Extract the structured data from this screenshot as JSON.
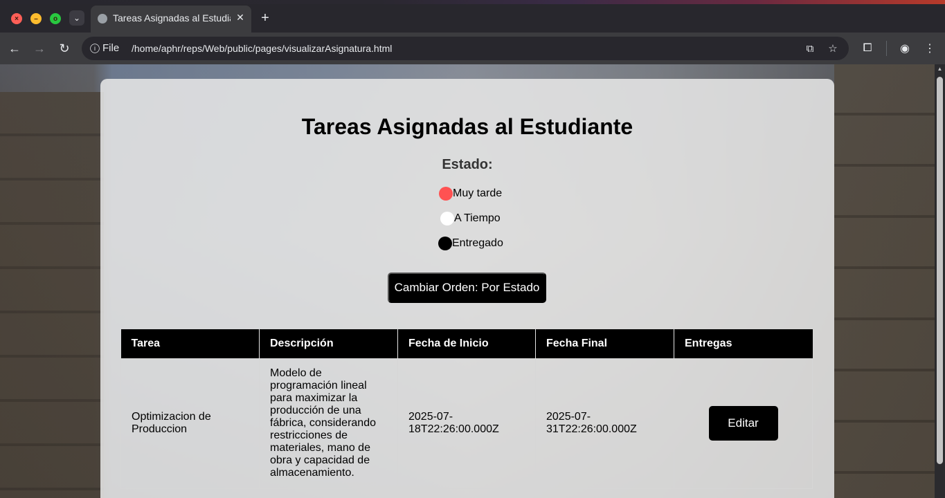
{
  "browser": {
    "tab_title": "Tareas Asignadas al Estudiante",
    "scheme_label": "File",
    "url": "/home/aphr/reps/Web/public/pages/visualizarAsignatura.html",
    "window_buttons": {
      "close": "×",
      "minimize": "–",
      "maximize": "o"
    }
  },
  "page": {
    "title": "Tareas Asignadas al Estudiante",
    "estado_heading": "Estado:",
    "legend": [
      {
        "label": "Muy tarde",
        "color": "#ff5252"
      },
      {
        "label": "A Tiempo",
        "color": "#ffffff"
      },
      {
        "label": "Entregado",
        "color": "#000000"
      }
    ],
    "order_button": "Cambiar Orden: Por Estado"
  },
  "table": {
    "headers": [
      "Tarea",
      "Descripción",
      "Fecha de Inicio",
      "Fecha Final",
      "Entregas"
    ],
    "rows": [
      {
        "tarea": "Optimizacion de Produccion",
        "descripcion": "Modelo de programación lineal para maximizar la producción de una fábrica, considerando restricciones de materiales, mano de obra y capacidad de almacenamiento.",
        "fecha_inicio": "2025-07-18T22:26:00.000Z",
        "fecha_final": "2025-07-31T22:26:00.000Z",
        "action_label": "Editar"
      }
    ]
  }
}
